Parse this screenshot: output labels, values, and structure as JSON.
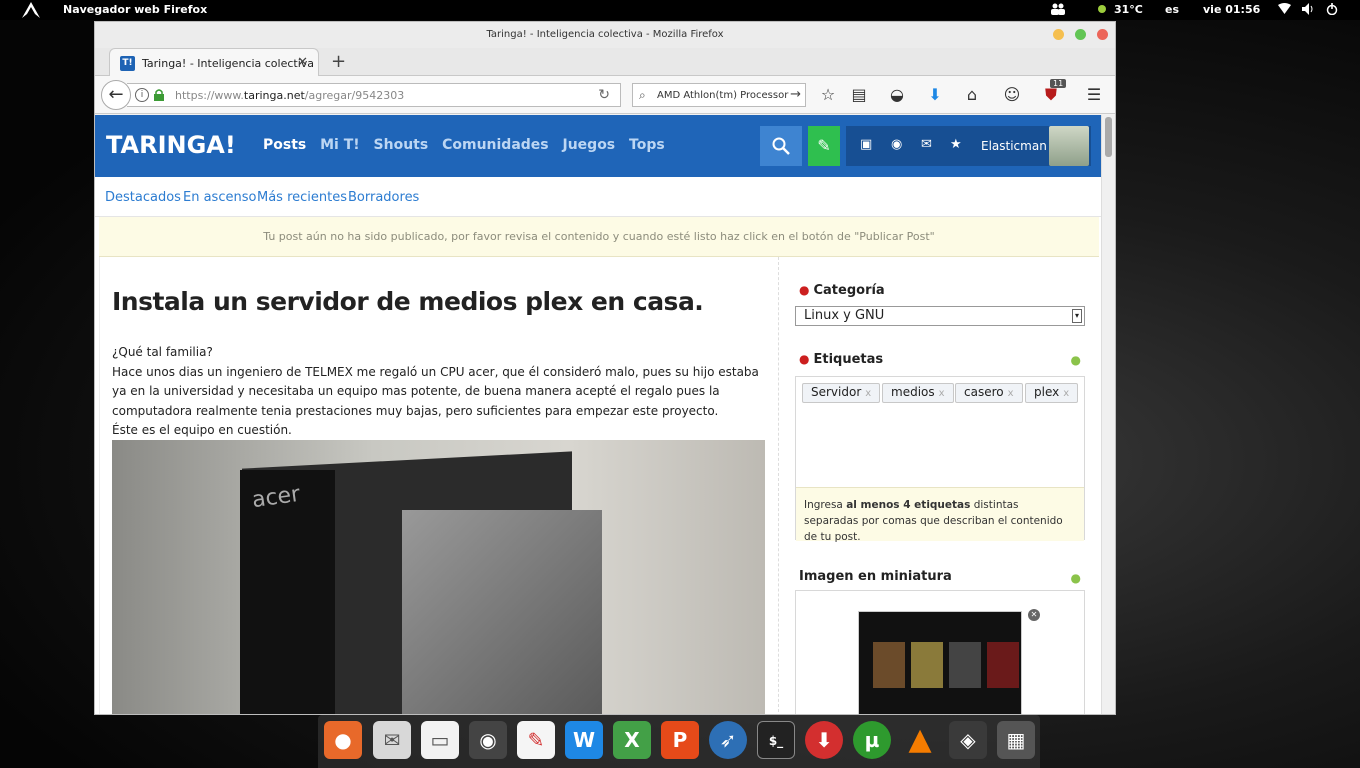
{
  "desktop": {
    "active_app": "Navegador web Firefox",
    "temperature": "31°C",
    "keyboard_layout": "es",
    "clock": "vie 01:56"
  },
  "window": {
    "title": "Taringa! - Inteligencia colectiva - Mozilla Firefox"
  },
  "tab": {
    "label": "Taringa! - Inteligencia colectiva",
    "favicon": "T!"
  },
  "navbar": {
    "url_prefix": "https://www.",
    "url_domain": "taringa.net",
    "url_path": "/agregar/9542303",
    "search_value": "AMD Athlon(tm) Processor",
    "extension_badge": "11"
  },
  "site": {
    "logo": "TARINGA!",
    "nav": [
      "Posts",
      "Mi T!",
      "Shouts",
      "Comunidades",
      "Juegos",
      "Tops"
    ],
    "username": "Elasticman",
    "subnav": [
      "Destacados",
      "En ascenso",
      "Más recientes",
      "Borradores"
    ],
    "notice": "Tu post aún no ha sido publicado, por favor revisa el contenido y cuando esté listo haz click en el botón de \"Publicar Post\""
  },
  "post": {
    "title": "Instala un servidor de medios plex en casa.",
    "greeting": "¿Qué tal familia?",
    "paragraph": "Hace unos dias un ingeniero de TELMEX me regaló un CPU acer, que él consideró malo, pues su hijo estaba ya en la universidad y necesitaba un equipo mas potente, de buena manera acepté el regalo pues la computadora realmente tenia prestaciones muy bajas, pero suficientes para empezar este proyecto.",
    "caption": "Éste es el equipo en cuestión.",
    "image_brand": "acer"
  },
  "sidebar": {
    "category_label": "Categoría",
    "category_value": "Linux y GNU",
    "tags_label": "Etiquetas",
    "tags": [
      "Servidor",
      "medios",
      "casero",
      "plex"
    ],
    "tags_hint_pre": "Ingresa ",
    "tags_hint_bold": "al menos 4 etiquetas",
    "tags_hint_post": " distintas separadas por comas que describan el contenido de tu post.",
    "thumbnail_label": "Imagen en miniatura"
  },
  "dock": {
    "apps": [
      "firefox-icon",
      "mail-icon",
      "files-icon",
      "disk-icon",
      "document-icon",
      "writer-icon",
      "spreadsheet-icon",
      "presentation-icon",
      "bird-icon",
      "terminal-icon",
      "download-icon",
      "torrent-icon",
      "vlc-icon",
      "system-icon",
      "network-icon"
    ]
  },
  "colors": {
    "taringa_blue": "#1f65b8",
    "post_green": "#2fbf4f",
    "notice_bg": "#fdfbe5"
  }
}
